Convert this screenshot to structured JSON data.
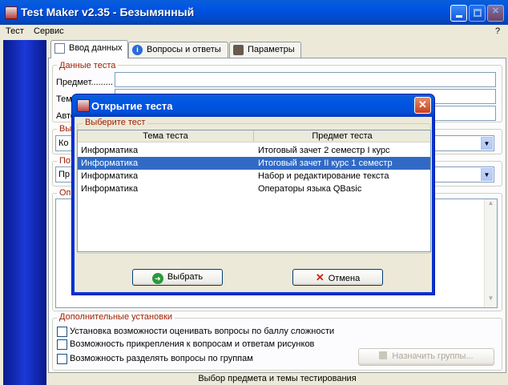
{
  "window": {
    "title": "Test Maker v2.35 - Безымянный",
    "help_label": "?"
  },
  "menu": [
    {
      "label": "Тест"
    },
    {
      "label": "Сервис"
    }
  ],
  "tabs": [
    {
      "label": "Ввод данных",
      "icon": "document-icon"
    },
    {
      "label": "Вопросы и ответы",
      "icon": "info-icon"
    },
    {
      "label": "Параметры",
      "icon": "tools-icon"
    }
  ],
  "main": {
    "test_data_title": "Данные теста",
    "subject_label": "Предмет.........",
    "theme_label_partial": "Тем",
    "author_label_partial": "Авто",
    "select_group_partial": "Вы",
    "select_value_partial": "Ко",
    "order_group_partial": "По",
    "order_value_partial": "Пр",
    "description_group_partial": "Опи",
    "extra_title": "Дополнительные установки",
    "options": [
      {
        "label": "Установка возможности оценивать вопросы по баллу сложности"
      },
      {
        "label": "Возможность прикрепления к вопросам и ответам рисунков"
      },
      {
        "label": "Возможность разделять вопросы по группам"
      }
    ],
    "assign_groups_label": "Назначить группы..."
  },
  "status": "Выбор предмета и темы тестирования",
  "dialog": {
    "title": "Открытие теста",
    "group_label": "Выберите тест",
    "columns": [
      "Тема теста",
      "Предмет теста"
    ],
    "rows": [
      {
        "theme": "Информатика",
        "subject": "Итоговый зачет 2 семестр I курс"
      },
      {
        "theme": "Информатика",
        "subject": "Итоговый зачет II курс 1 семестр"
      },
      {
        "theme": "Информатика",
        "subject": "Набор и редактирование текста"
      },
      {
        "theme": "Информатика",
        "subject": "Операторы языка QBasic"
      }
    ],
    "selected_row": 2,
    "ok_label": "Выбрать",
    "cancel_label": "Отмена"
  }
}
